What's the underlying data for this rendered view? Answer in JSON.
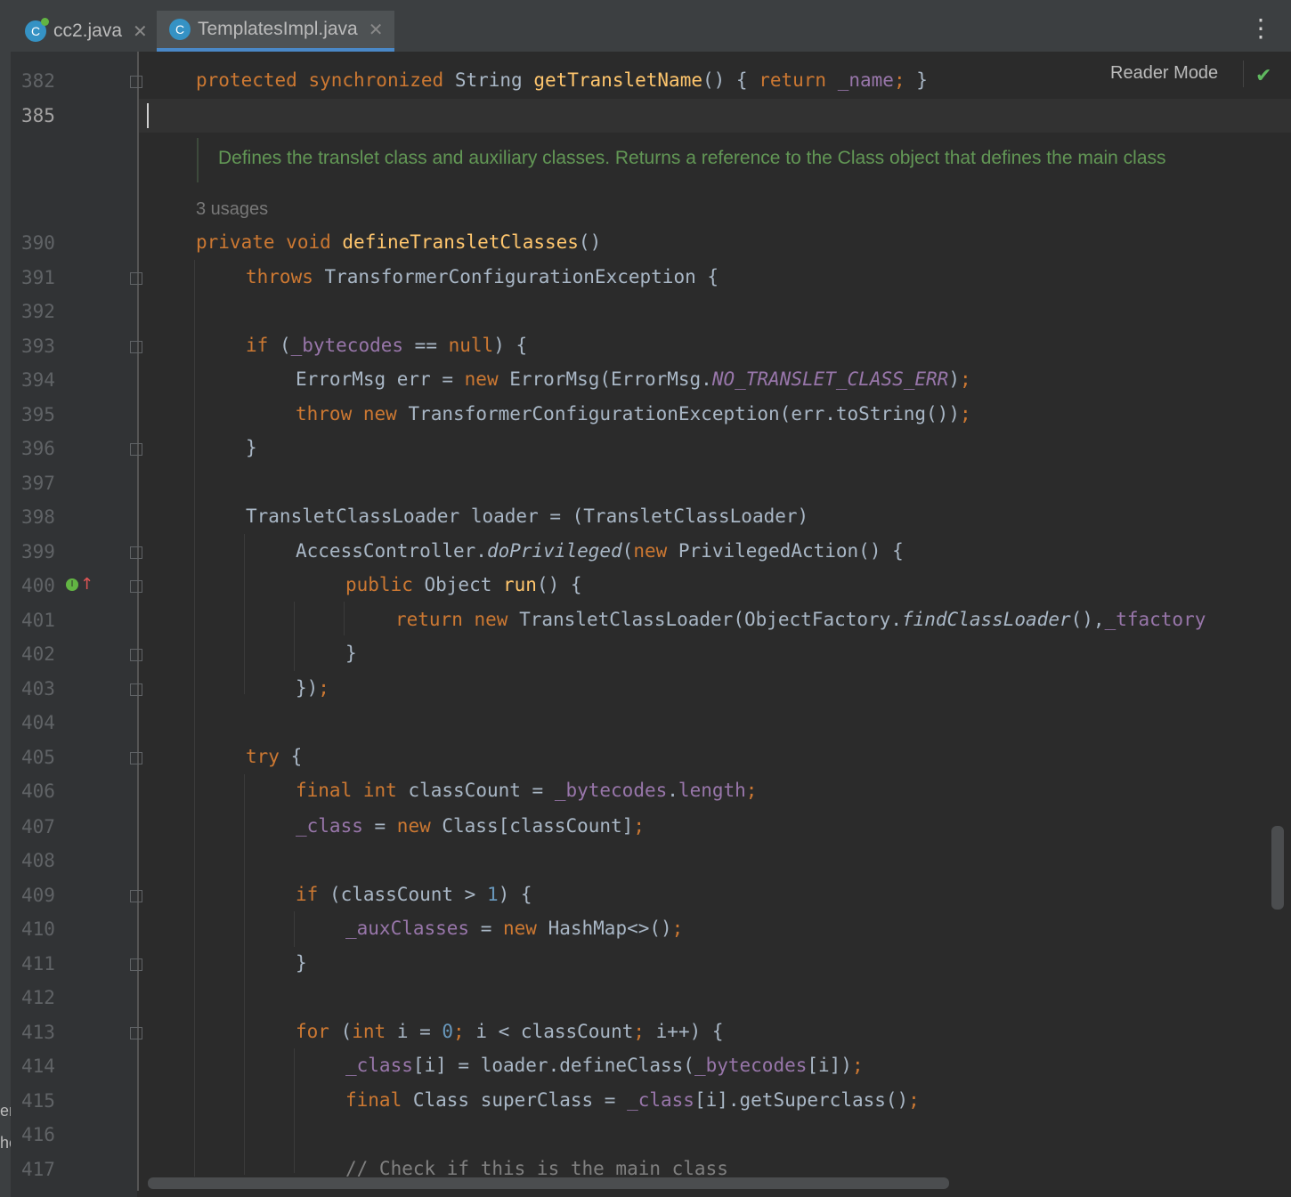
{
  "tabs": [
    {
      "label": "cc2.java",
      "icon": "class-icon",
      "active": false
    },
    {
      "label": "TemplatesImpl.java",
      "icon": "class-icon",
      "active": true
    }
  ],
  "toolbar": {
    "reader_mode": "Reader Mode"
  },
  "doc_comment": "Defines the translet class and auxiliary classes. Returns a reference to the Class object that defines the main class",
  "usages": "3 usages",
  "line_numbers": [
    "382",
    "385",
    "390",
    "391",
    "392",
    "393",
    "394",
    "395",
    "396",
    "397",
    "398",
    "399",
    "400",
    "401",
    "402",
    "403",
    "404",
    "405",
    "406",
    "407",
    "408",
    "409",
    "410",
    "411",
    "412",
    "413",
    "414",
    "415",
    "416",
    "417"
  ],
  "code": {
    "l382": "protected synchronized String getTransletName() { return _name; }",
    "l390": "private void defineTransletClasses()",
    "l391": "throws TransformerConfigurationException {",
    "l393": "if (_bytecodes == null) {",
    "l394": "ErrorMsg err = new ErrorMsg(ErrorMsg.NO_TRANSLET_CLASS_ERR);",
    "l395": "throw new TransformerConfigurationException(err.toString());",
    "l396": "}",
    "l398": "TransletClassLoader loader = (TransletClassLoader)",
    "l399": "AccessController.doPrivileged(new PrivilegedAction() {",
    "l400": "public Object run() {",
    "l401": "return new TransletClassLoader(ObjectFactory.findClassLoader(),_tfactory",
    "l402": "}",
    "l403": "});",
    "l405": "try {",
    "l406": "final int classCount = _bytecodes.length;",
    "l407": "_class = new Class[classCount];",
    "l409": "if (classCount > 1) {",
    "l410": "_auxClasses = new HashMap<>();",
    "l411": "}",
    "l413": "for (int i = 0; i < classCount; i++) {",
    "l414": "_class[i] = loader.defineClass(_bytecodes[i]);",
    "l415": "final Class superClass = _class[i].getSuperclass();",
    "l417": "// Check if this is the main class"
  }
}
